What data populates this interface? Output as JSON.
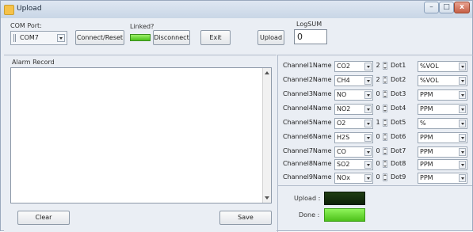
{
  "window": {
    "title": "Upload",
    "min_glyph": "–",
    "max_glyph": "□",
    "close_glyph": "x"
  },
  "top": {
    "com_port_label": "COM Port:",
    "com_port_value": "COM7",
    "connect_reset_label": "Connect/Reset",
    "linked_label": "Linked?",
    "linked_state_color": "#4cc21b",
    "disconnect_label": "Disconnect",
    "exit_label": "Exit",
    "upload_label": "Upload",
    "logsum_label": "LogSUM",
    "logsum_value": "0"
  },
  "alarm": {
    "label": "Alarm Record",
    "clear_label": "Clear",
    "save_label": "Save"
  },
  "channels": [
    {
      "name_label": "Channel1Name :",
      "name": "CO2",
      "dot_value": "2",
      "dot_label": "Dot1",
      "unit": "%VOL"
    },
    {
      "name_label": "Channel2Name :",
      "name": "CH4",
      "dot_value": "2",
      "dot_label": "Dot2",
      "unit": "%VOL"
    },
    {
      "name_label": "Channel3Name :",
      "name": "NO",
      "dot_value": "0",
      "dot_label": "Dot3",
      "unit": "PPM"
    },
    {
      "name_label": "Channel4Name :",
      "name": "NO2",
      "dot_value": "0",
      "dot_label": "Dot4",
      "unit": "PPM"
    },
    {
      "name_label": "Channel5Name :",
      "name": "O2",
      "dot_value": "1",
      "dot_label": "Dot5",
      "unit": "%"
    },
    {
      "name_label": "Channel6Name :",
      "name": "H2S",
      "dot_value": "0",
      "dot_label": "Dot6",
      "unit": "PPM"
    },
    {
      "name_label": "Channel7Name :",
      "name": "CO",
      "dot_value": "0",
      "dot_label": "Dot7",
      "unit": "PPM"
    },
    {
      "name_label": "Channel8Name :",
      "name": "SO2",
      "dot_value": "0",
      "dot_label": "Dot8",
      "unit": "PPM"
    },
    {
      "name_label": "Channel9Name :",
      "name": "NOx",
      "dot_value": "0",
      "dot_label": "Dot9",
      "unit": "PPM"
    }
  ],
  "status": {
    "upload_label": "Upload :",
    "upload_led_color": "#1f3d12",
    "done_label": "Done :",
    "done_led_color": "#4ec11b"
  }
}
